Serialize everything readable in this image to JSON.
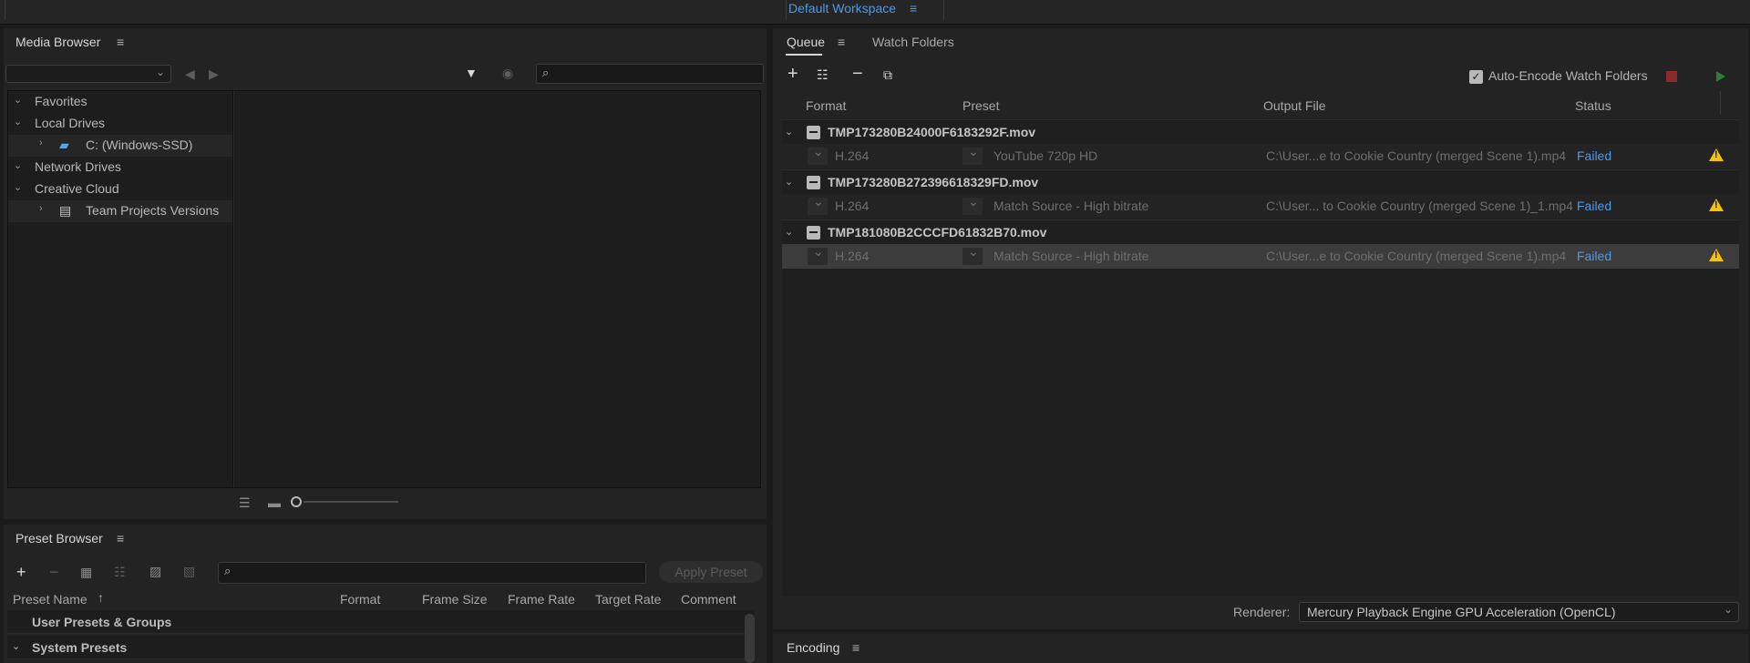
{
  "workspace": {
    "label": "Default Workspace",
    "menu_icon": "hamburger-icon"
  },
  "media_browser": {
    "title": "Media Browser",
    "dropdown_value": "",
    "search_placeholder": "",
    "tree": [
      {
        "label": "Favorites",
        "expanded": true
      },
      {
        "label": "Local Drives",
        "expanded": true
      },
      {
        "label": "C: (Windows-SSD)",
        "child": true,
        "icon": "drive-icon"
      },
      {
        "label": "Network Drives",
        "expanded": true
      },
      {
        "label": "Creative Cloud",
        "expanded": true
      },
      {
        "label": "Team Projects Versions",
        "child": true,
        "icon": "team-projects-icon"
      }
    ]
  },
  "preset_browser": {
    "title": "Preset Browser",
    "apply_preset_label": "Apply Preset",
    "search_placeholder": "",
    "columns": [
      "Preset Name",
      "Format",
      "Frame Size",
      "Frame Rate",
      "Target Rate",
      "Comment"
    ],
    "rows": [
      {
        "label": "User Presets & Groups"
      },
      {
        "label": "System Presets",
        "expanded": true
      }
    ]
  },
  "queue": {
    "tab_queue": "Queue",
    "tab_watch_folders": "Watch Folders",
    "auto_encode_label": "Auto-Encode Watch Folders",
    "auto_encode_checked": true,
    "columns": {
      "format": "Format",
      "preset": "Preset",
      "output": "Output File",
      "status": "Status"
    },
    "groups": [
      {
        "name": "TMP173280B24000F6183292F.mov",
        "item": {
          "format": "H.264",
          "preset": "YouTube 720p HD",
          "output": "C:\\User...e to Cookie Country (merged Scene 1).mp4",
          "status": "Failed"
        }
      },
      {
        "name": "TMP173280B272396618329FD.mov",
        "item": {
          "format": "H.264",
          "preset": "Match Source - High bitrate",
          "output": "C:\\User... to Cookie Country (merged Scene 1)_1.mp4",
          "status": "Failed"
        }
      },
      {
        "name": "TMP181080B2CCCFD61832B70.mov",
        "item": {
          "format": "H.264",
          "preset": "Match Source - High bitrate",
          "output": "C:\\User...e to Cookie Country (merged Scene 1).mp4",
          "status": "Failed"
        }
      }
    ],
    "renderer_label": "Renderer:",
    "renderer_value": "Mercury Playback Engine GPU Acceleration (OpenCL)"
  },
  "encoding": {
    "title": "Encoding"
  },
  "colors": {
    "accent": "#4a9be8",
    "warning": "#f4c20d",
    "stop": "#8a2a2a",
    "play": "#2f7d2f"
  }
}
